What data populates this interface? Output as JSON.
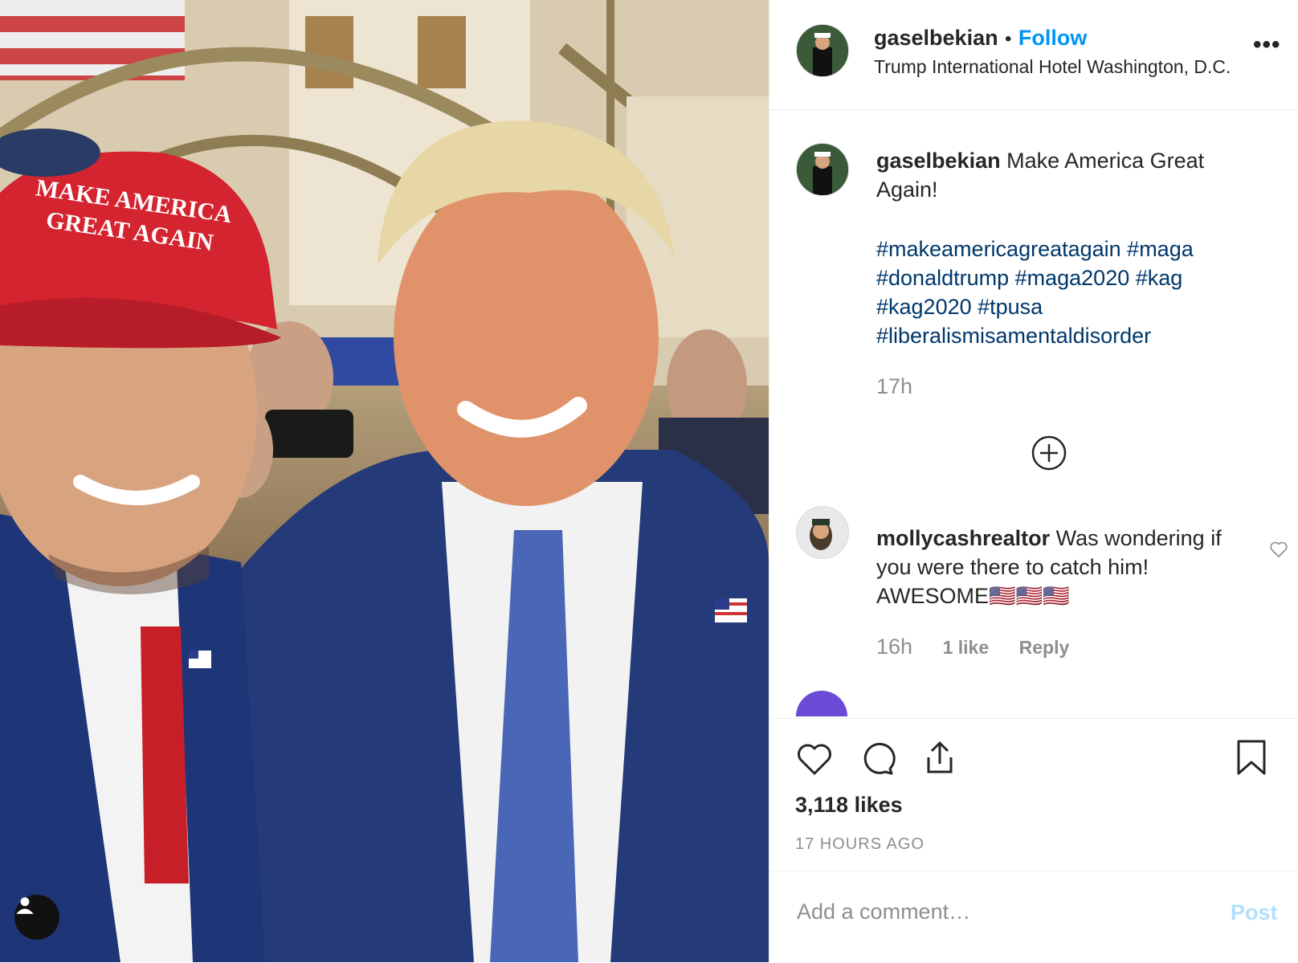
{
  "post": {
    "username": "gaselbekian",
    "separator": "•",
    "follow_label": "Follow",
    "location": "Trump International Hotel Washington, D.C.",
    "more_label": "•••",
    "caption_user": "gaselbekian",
    "caption_text": "Make America Great Again!",
    "hashtags": "#makeamericagreatagain #maga #donaldtrump #maga2020 #kag #kag2020 #tpusa #liberalismisamentaldisorder",
    "time": "17h",
    "likes": "3,118 likes",
    "posted_ago": "17 HOURS AGO"
  },
  "photo": {
    "hat_line1": "MAKE AMERICA",
    "hat_line2": "GREAT AGAIN"
  },
  "comments": [
    {
      "user": "mollycashrealtor",
      "text": "Was wondering if you were there to catch him! AWESOME🇺🇸🇺🇸🇺🇸",
      "time": "16h",
      "likes": "1 like",
      "reply": "Reply"
    }
  ],
  "composer": {
    "placeholder": "Add a comment…",
    "post_label": "Post"
  },
  "colors": {
    "accent": "#0095f6",
    "hashtag": "#00376b",
    "muted": "#8e8e8e",
    "post_disabled": "#b2dffc"
  },
  "icons": [
    "user-tag-icon",
    "add-circle-icon",
    "heart-icon",
    "comment-icon",
    "share-icon",
    "bookmark-icon",
    "more-icon"
  ]
}
